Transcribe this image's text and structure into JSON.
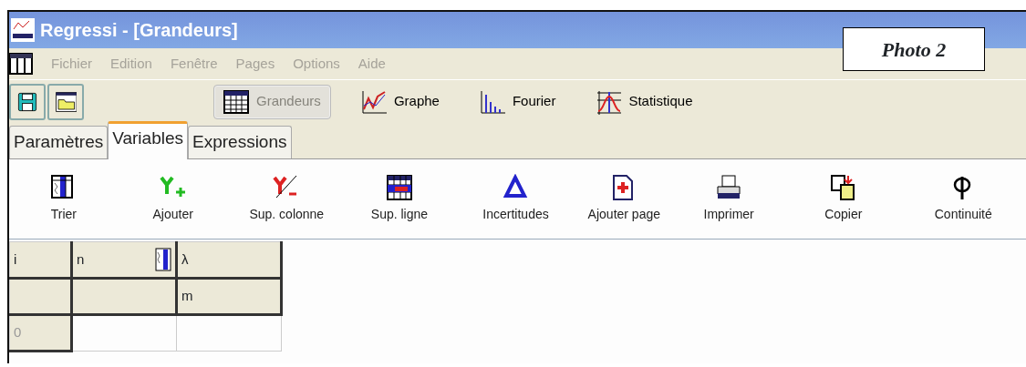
{
  "window": {
    "title": "Regressi  - [Grandeurs]"
  },
  "caption": {
    "text": "Photo 2"
  },
  "menu": [
    {
      "label": "Fichier",
      "disabled": true
    },
    {
      "label": "Edition",
      "disabled": true
    },
    {
      "label": "Fenêtre",
      "disabled": true
    },
    {
      "label": "Pages",
      "disabled": true
    },
    {
      "label": "Options",
      "disabled": true
    },
    {
      "label": "Aide",
      "disabled": true
    }
  ],
  "toolbar": {
    "file_buttons": [
      {
        "kind": "save"
      },
      {
        "kind": "open"
      }
    ],
    "views": [
      {
        "label": "Grandeurs",
        "kind": "table",
        "selected": true
      },
      {
        "label": "Graphe",
        "kind": "graph",
        "selected": false
      },
      {
        "label": "Fourier",
        "kind": "fourier",
        "selected": false
      },
      {
        "label": "Statistique",
        "kind": "stats",
        "selected": false
      }
    ]
  },
  "tabs": [
    {
      "label": "Paramètres",
      "selected": false
    },
    {
      "label": "Variables",
      "selected": true
    },
    {
      "label": "Expressions",
      "selected": false
    }
  ],
  "actions": [
    {
      "label": "Trier",
      "kind": "sort"
    },
    {
      "label": "Ajouter",
      "kind": "add"
    },
    {
      "label": "Sup. colonne",
      "kind": "delcol"
    },
    {
      "label": "Sup. ligne",
      "kind": "delrow"
    },
    {
      "label": "Incertitudes",
      "kind": "delta"
    },
    {
      "label": "Ajouter page",
      "kind": "addpage"
    },
    {
      "label": "Imprimer",
      "kind": "print"
    },
    {
      "label": "Copier",
      "kind": "copy"
    },
    {
      "label": "Continuité",
      "kind": "phi"
    }
  ],
  "table": {
    "header_rows": [
      [
        {
          "text": "i",
          "sort_icon": false
        },
        {
          "text": "n",
          "sort_icon": true
        },
        {
          "text": "λ",
          "sort_icon": false
        }
      ],
      [
        {
          "text": "",
          "sort_icon": false
        },
        {
          "text": "",
          "sort_icon": false
        },
        {
          "text": "m",
          "sort_icon": false
        }
      ]
    ],
    "rows": [
      {
        "index": "0",
        "cells": [
          "",
          ""
        ]
      }
    ]
  }
}
